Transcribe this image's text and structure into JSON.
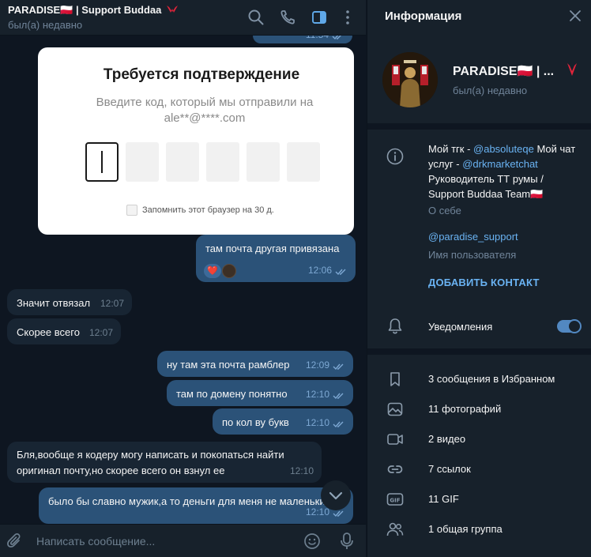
{
  "chat": {
    "title": "PARADISE🇵🇱 | Support Buddaa",
    "status": "был(а) недавно",
    "top_partial_time": "11:54"
  },
  "image_message": {
    "title": "Требуется подтверждение",
    "subtitle": "Введите код, который мы отправили на ale**@****.com",
    "remember": "Запомнить этот браузер на 30 д."
  },
  "messages": [
    {
      "dir": "out",
      "text": "там почта другая привязана",
      "time": "12:06",
      "reactions": [
        "❤️"
      ]
    },
    {
      "dir": "in",
      "text": "Значит отвязал",
      "time": "12:07"
    },
    {
      "dir": "in",
      "text": "Скорее всего",
      "time": "12:07"
    },
    {
      "dir": "out",
      "text": "ну там эта почта рамблер",
      "time": "12:09"
    },
    {
      "dir": "out",
      "text": "там по домену понятно",
      "time": "12:10"
    },
    {
      "dir": "out",
      "text": "по кол ву букв",
      "time": "12:10"
    },
    {
      "dir": "in",
      "text": "Бля,вообще я кодеру могу написать и покопаться найти",
      "text2": "оригинал почту,но скорее всего он взнул ее",
      "time": "12:10"
    },
    {
      "dir": "out",
      "text": "было бы славно мужик,а то деньги для меня не маленькие",
      "time": "12:10"
    }
  ],
  "composer": {
    "placeholder": "Написать сообщение..."
  },
  "info": {
    "title": "Информация",
    "name": "PARADISE🇵🇱 | ...",
    "status": "был(а) недавно",
    "about_parts": [
      "Мой тгк - ",
      "@absoluteqe",
      " Мой чат услуг - ",
      "@drkmarketchat",
      " Руководитель ТТ румы / Support Buddaa Team🇵🇱"
    ],
    "about_caption": "О себе",
    "username": "@paradise_support",
    "username_caption": "Имя пользователя",
    "add_contact": "ДОБАВИТЬ КОНТАКТ",
    "notifications": "Уведомления",
    "notifications_on": true,
    "media": [
      {
        "icon": "bookmark-icon",
        "label": "3 сообщения в Избранном"
      },
      {
        "icon": "photo-icon",
        "label": "11 фотографий"
      },
      {
        "icon": "video-icon",
        "label": "2 видео"
      },
      {
        "icon": "link-icon",
        "label": "7 ссылок"
      },
      {
        "icon": "gif-icon",
        "label": "11 GIF"
      },
      {
        "icon": "group-icon",
        "label": "1 общая группа"
      }
    ]
  },
  "colors": {
    "chat_bg": "#0e1621",
    "panel_bg": "#17212b",
    "outgoing_bubble": "#2b5278",
    "incoming_bubble": "#182533",
    "accent": "#6ab3f3"
  }
}
